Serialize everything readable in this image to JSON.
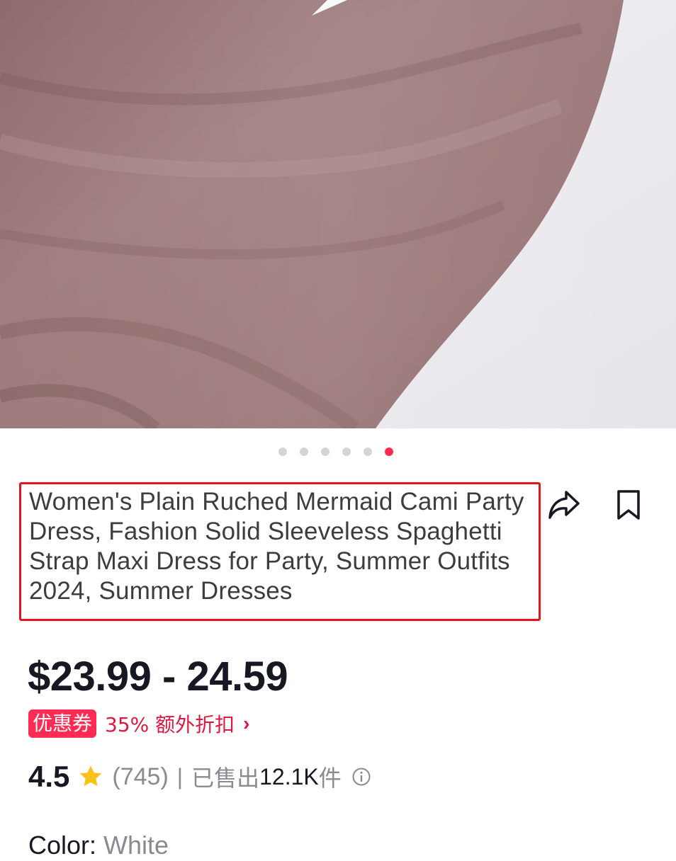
{
  "product": {
    "title": "Women's Plain Ruched Mermaid Cami Party Dress, Fashion Solid Sleeveless Spaghetti Strap Maxi Dress for Party, Summer Outfits 2024, Summer Dresses",
    "price": "$23.99 - 24.59",
    "image_dots_active": 6,
    "image_dots_total": 6
  },
  "promo": {
    "coupon_label": "优惠券",
    "discount_text": "35% 额外折扣",
    "chevron": "›"
  },
  "stats": {
    "rating": "4.5",
    "reviews": "(745)",
    "separator": "|",
    "sold_label": "已售出",
    "sold_count": "12.1K",
    "sold_unit": "件"
  },
  "variant": {
    "color_label": "Color:",
    "color_value": "White"
  },
  "icons": {
    "share": "share-icon",
    "save": "bookmark-icon",
    "star": "star-icon",
    "info": "info-icon"
  },
  "colors": {
    "accent": "#fe2c55",
    "highlight_border": "#e8141c",
    "star": "#f8c21b"
  }
}
